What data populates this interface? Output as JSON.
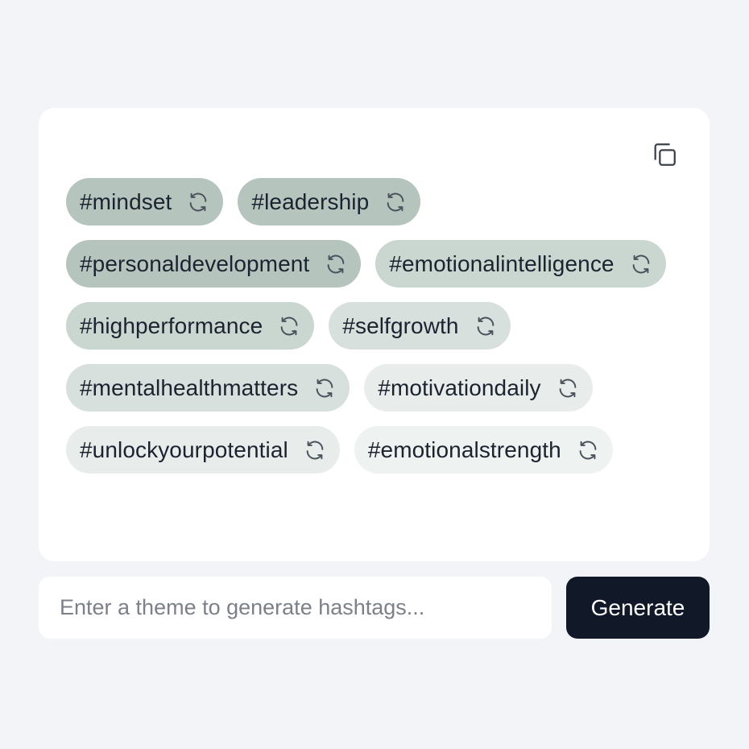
{
  "colors": {
    "background": "#f2f4f8",
    "card": "#ffffff",
    "tag_dark": "#b5c5bd",
    "tag_mid": "#cad6d0",
    "tag_light": "#e6ecea",
    "tag_lightest": "#eef2f1",
    "button": "#111827"
  },
  "copy_button": {
    "icon": "copy-icon"
  },
  "hashtags": [
    {
      "label": "#mindset",
      "color": "#b5c5bd"
    },
    {
      "label": "#leadership",
      "color": "#b5c5bd"
    },
    {
      "label": "#personaldevelopment",
      "color": "#b5c5bd"
    },
    {
      "label": "#emotionalintelligence",
      "color": "#cad6d0"
    },
    {
      "label": "#highperformance",
      "color": "#cad6d0"
    },
    {
      "label": "#selfgrowth",
      "color": "#d7e0dc"
    },
    {
      "label": "#mentalhealthmatters",
      "color": "#d7e0dc"
    },
    {
      "label": "#motivationdaily",
      "color": "#e8edeb"
    },
    {
      "label": "#unlockyourpotential",
      "color": "#e8edeb"
    },
    {
      "label": "#emotionalstrength",
      "color": "#eef2f1"
    }
  ],
  "tag_icon": "refresh-icon",
  "input": {
    "value": "",
    "placeholder": "Enter a theme to generate hashtags..."
  },
  "generate_button": {
    "label": "Generate"
  }
}
